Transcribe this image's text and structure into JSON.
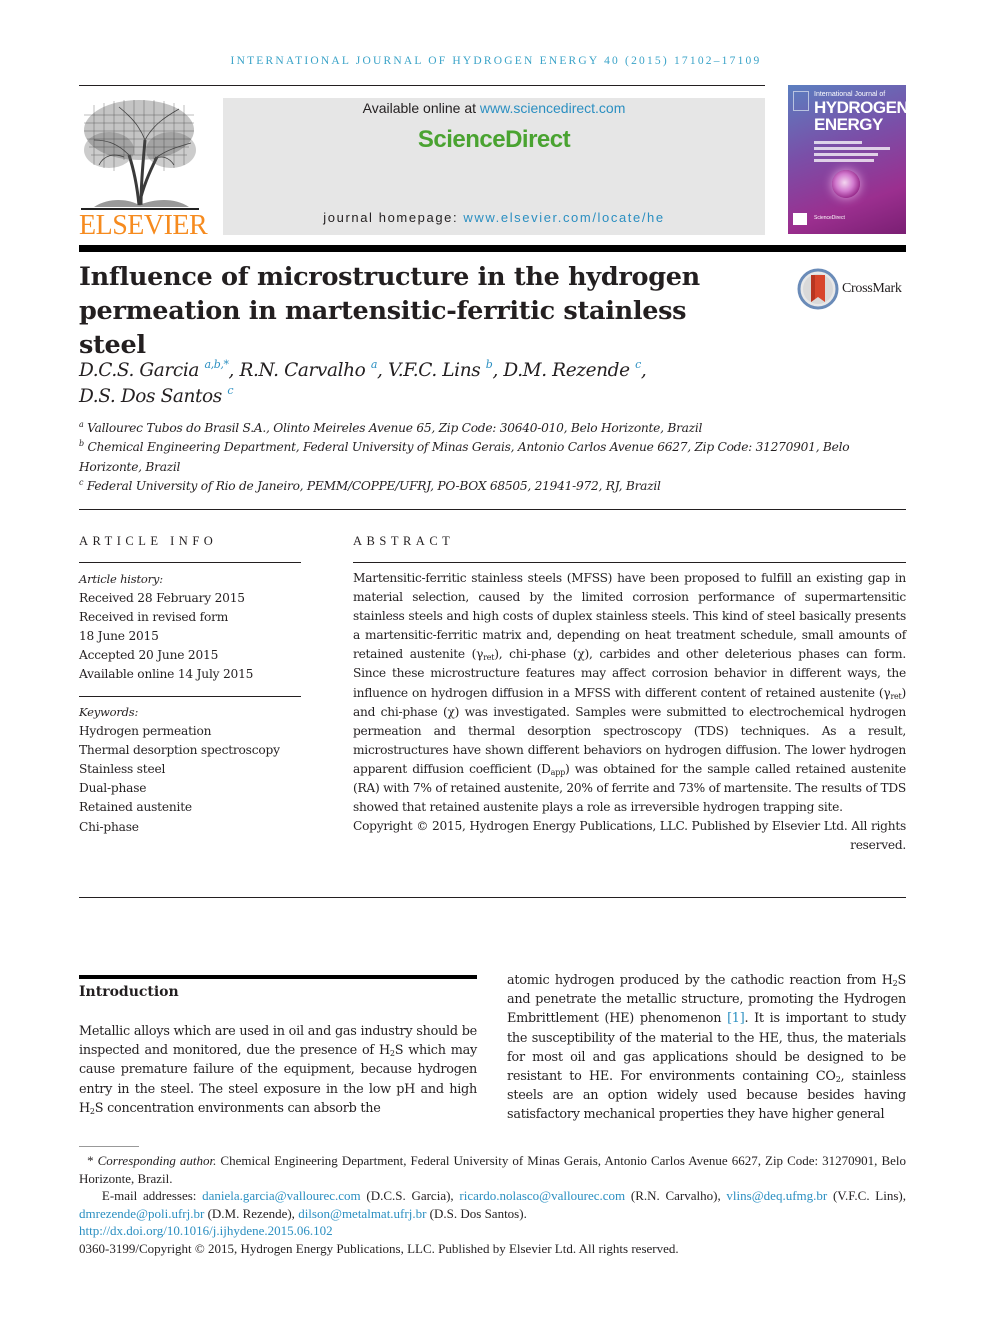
{
  "header": {
    "journal_running_head": "INTERNATIONAL JOURNAL OF HYDROGEN ENERGY 40 (2015) 17102–17109",
    "publisher_logo_text": "ELSEVIER",
    "available_online_prefix": "Available online at ",
    "available_online_link": "www.sciencedirect.com",
    "sciencedirect_brand": "ScienceDirect",
    "journal_homepage_prefix": "journal homepage: ",
    "journal_homepage_link": "www.elsevier.com/locate/he",
    "cover": {
      "line1": "International Journal of",
      "line2": "HYDROGEN",
      "line3": "ENERGY",
      "footer": "ScienceDirect"
    },
    "colors": {
      "link": "#2b8fc1",
      "elsevier_orange": "#f68b1f",
      "sciencedirect_green": "#4aa331",
      "banner_gray": "#e6e6e6"
    }
  },
  "article": {
    "title_line1": "Influence of microstructure in the hydrogen",
    "title_line2": "permeation in martensitic-ferritic stainless steel",
    "crossmark_label": "CrossMark",
    "authors": [
      {
        "name": "D.C.S. Garcia",
        "sup": "a,b,*",
        "sep": ", "
      },
      {
        "name": "R.N. Carvalho",
        "sup": "a",
        "sep": ", "
      },
      {
        "name": "V.F.C. Lins",
        "sup": "b",
        "sep": ", "
      },
      {
        "name": "D.M. Rezende",
        "sup": "c",
        "sep": ","
      },
      {
        "name": "D.S. Dos Santos",
        "sup": "c",
        "sep": ""
      }
    ],
    "affiliations": [
      {
        "key": "a",
        "text": "Vallourec Tubos do Brasil S.A., Olinto Meireles Avenue 65, Zip Code: 30640-010, Belo Horizonte, Brazil"
      },
      {
        "key": "b",
        "text": "Chemical Engineering Department, Federal University of Minas Gerais, Antonio Carlos Avenue 6627, Zip Code: 31270901, Belo Horizonte, Brazil"
      },
      {
        "key": "c",
        "text": "Federal University of Rio de Janeiro, PEMM/COPPE/UFRJ, PO-BOX 68505, 21941-972, RJ, Brazil"
      }
    ]
  },
  "article_info": {
    "heading": "ARTICLE INFO",
    "history_label": "Article history:",
    "history": [
      "Received 28 February 2015",
      "Received in revised form",
      "18 June 2015",
      "Accepted 20 June 2015",
      "Available online 14 July 2015"
    ],
    "keywords_label": "Keywords:",
    "keywords": [
      "Hydrogen permeation",
      "Thermal desorption spectroscopy",
      "Stainless steel",
      "Dual-phase",
      "Retained austenite",
      "Chi-phase"
    ]
  },
  "abstract": {
    "heading": "ABSTRACT",
    "p1": "Martensitic-ferritic stainless steels (MFSS) have been proposed to fulfill an existing gap in material selection, caused by the limited corrosion performance of supermartensitic stainless steels and high costs of duplex stainless steels. This kind of steel basically presents a martensitic-ferritic matrix and, depending on heat treatment schedule, small amounts of retained austenite (",
    "gamma": "γ",
    "ret": "ret",
    "p2": "), chi-phase (χ), carbides and other deleterious phases can form. Since these microstructure features may affect corrosion behavior in different ways, the influence on hydrogen diffusion in a MFSS with different content of retained austenite (",
    "p3": ") and chi-phase (χ) was investigated. Samples were submitted to electrochemical hydrogen permeation and thermal desorption spectroscopy (TDS) techniques. As a result, microstructures have shown different behaviors on hydrogen diffusion. The lower hydrogen apparent diffusion coefficient (D",
    "app": "app",
    "p4": ") was obtained for the sample called retained austenite (RA) with 7% of retained austenite, 20% of ferrite and 73% of martensite. The results of TDS showed that retained austenite plays a role as irreversible hydrogen trapping site.",
    "copyright": "Copyright © 2015, Hydrogen Energy Publications, LLC. Published by Elsevier Ltd. All rights reserved."
  },
  "introduction": {
    "heading": "Introduction",
    "left_a": "Metallic alloys which are used in oil and gas industry should be inspected and monitored, due the presence of H",
    "left_b": "S which may cause premature failure of the equipment, because hydrogen entry in the steel. The steel exposure in the low pH and high H",
    "left_c": "S concentration environments can absorb the",
    "right_a": "atomic hydrogen produced by the cathodic reaction from H",
    "right_b": "S and penetrate the metallic structure, promoting the Hydrogen Embrittlement (HE) phenomenon ",
    "ref1": "[1]",
    "right_c": ". It is important to study the susceptibility of the material to the HE, thus, the materials for most oil and gas applications should be designed to be resistant to HE. For environments containing CO",
    "right_d": ", stainless steels are an option widely used because besides having satisfactory mechanical properties they have higher general",
    "sub2": "2"
  },
  "footnotes": {
    "corr_star": "* ",
    "corr_label": "Corresponding author.",
    "corr_text": " Chemical Engineering Department, Federal University of Minas Gerais, Antonio Carlos Avenue 6627, Zip Code: 31270901, Belo Horizonte, Brazil.",
    "email_label": "E-mail addresses: ",
    "emails": [
      {
        "email": "daniela.garcia@vallourec.com",
        "who": " (D.C.S. Garcia), "
      },
      {
        "email": "ricardo.nolasco@vallourec.com",
        "who": " (R.N. Carvalho), "
      },
      {
        "email": "vlins@deq.ufmg.br",
        "who": " (V.F.C. Lins), "
      },
      {
        "email": "dmrezende@poli.ufrj.br",
        "who": " (D.M. Rezende), "
      },
      {
        "email": "dilson@metalmat.ufrj.br",
        "who": " (D.S. Dos Santos)."
      }
    ],
    "doi": "http://dx.doi.org/10.1016/j.ijhydene.2015.06.102",
    "issn_copyright": "0360-3199/Copyright © 2015, Hydrogen Energy Publications, LLC. Published by Elsevier Ltd. All rights reserved."
  }
}
